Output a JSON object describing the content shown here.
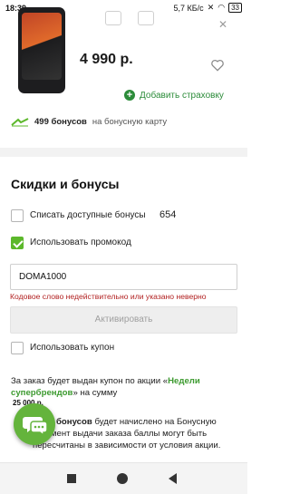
{
  "status_bar": {
    "time": "18:39",
    "net_speed": "5,7 КБ/с",
    "battery": "33"
  },
  "product": {
    "price": "4 990 р.",
    "add_insurance_label": "Добавить страховку",
    "close_icon": "close-icon",
    "favorite_icon": "heart-outline-icon"
  },
  "bonus_line": {
    "amount": "499 бонусов",
    "tail": "на бонусную карту"
  },
  "discounts": {
    "title": "Скидки и бонусы",
    "spend_bonuses_label": "Списать доступные бонусы",
    "available_bonuses": "654",
    "use_promo_label": "Использовать промокод",
    "promo_value": "DOMA1000",
    "promo_error": "Кодовое слово недействительно или указано неверно",
    "activate_label": "Активировать",
    "use_coupon_label": "Использовать купон"
  },
  "coupon_info": {
    "text_before": "За заказ будет выдан купон по акции «",
    "link": "Недели супербрендов",
    "text_after": "» на сумму",
    "amount": "25 000 р."
  },
  "bonus_info": {
    "bold": "бонусов",
    "text1": "будет начислено на Бонусную",
    "text2": "...момент выдачи заказа баллы могут быть пересчитаны в зависимости от условия акции."
  },
  "colors": {
    "accent_green": "#5cb82b",
    "link_green": "#3c9a2f",
    "error_red": "#b11f1f"
  }
}
